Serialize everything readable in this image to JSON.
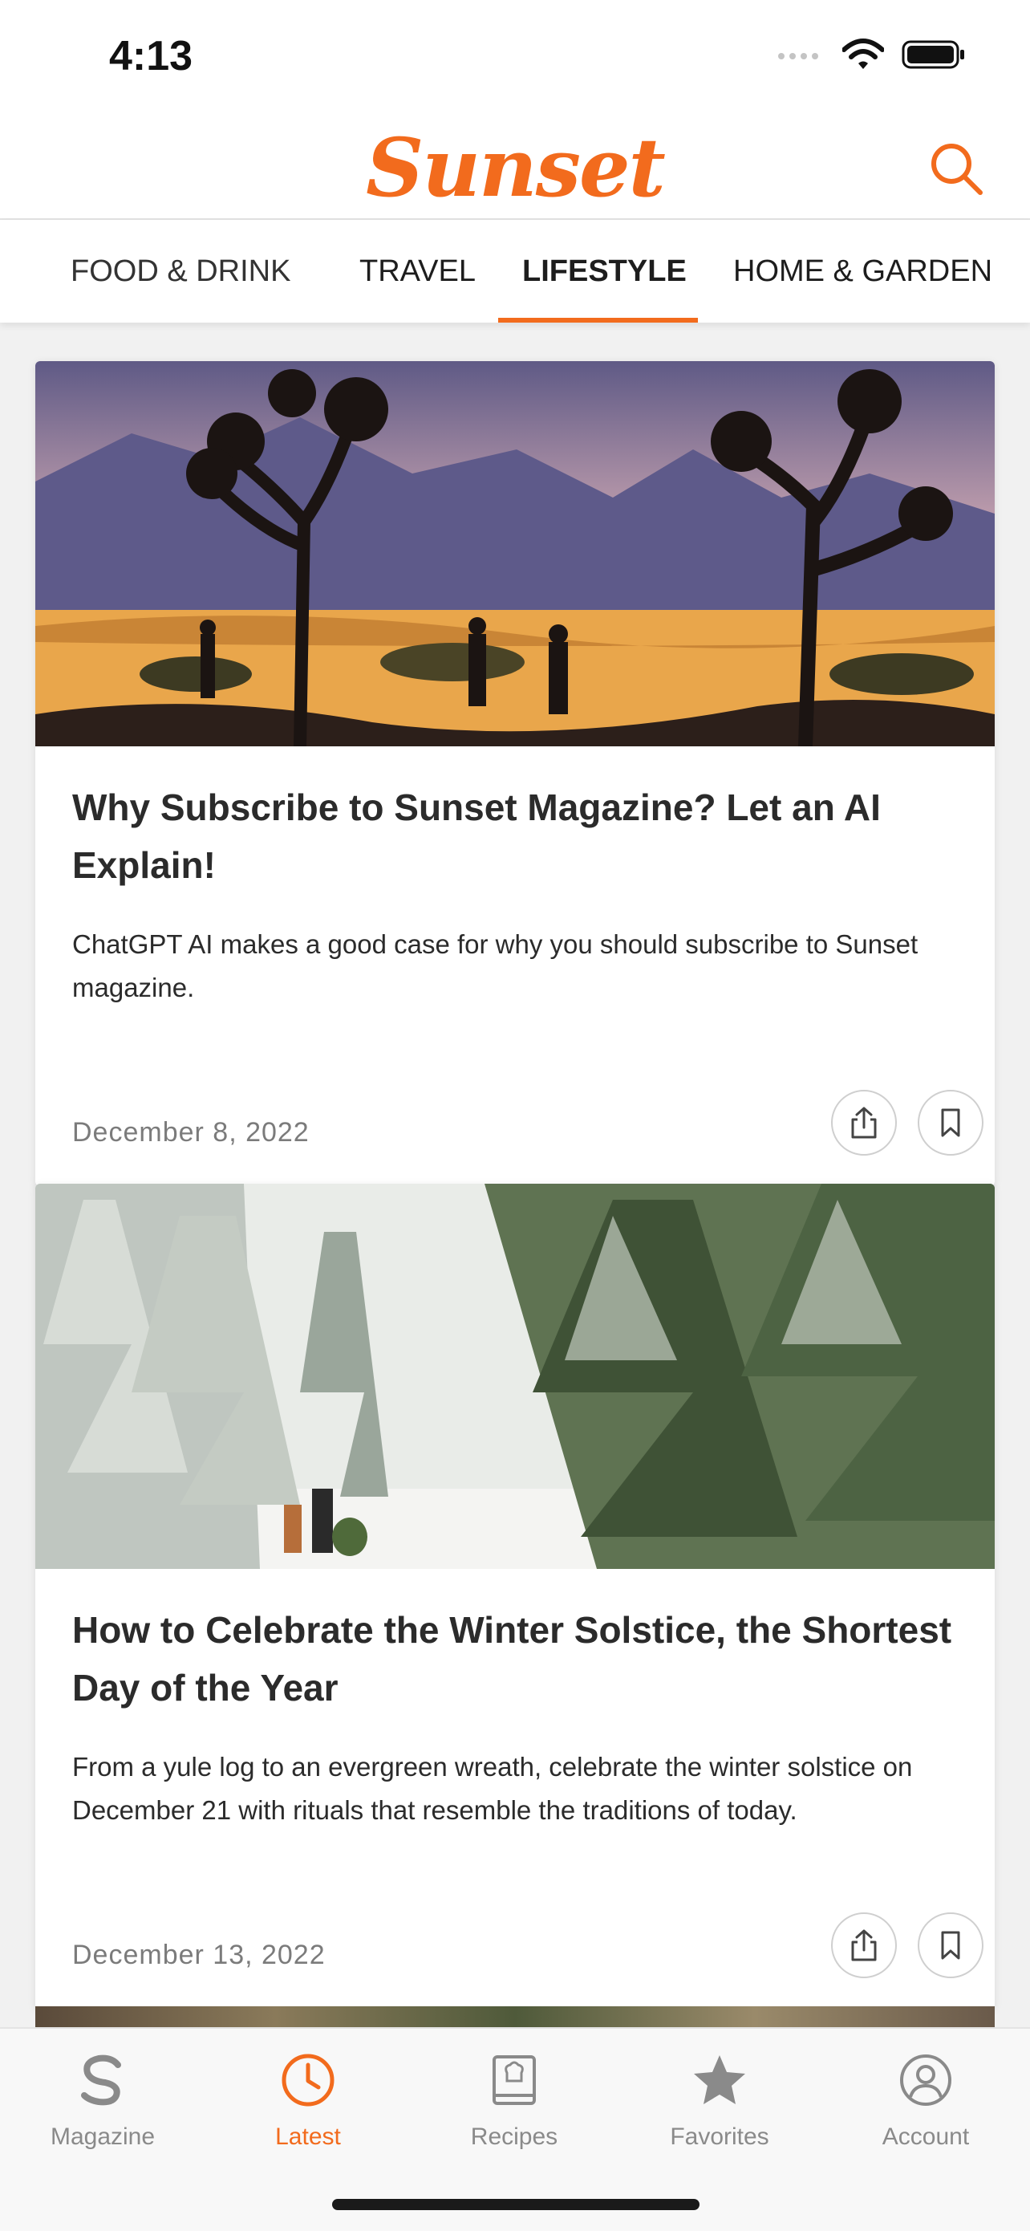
{
  "status_bar": {
    "time": "4:13"
  },
  "header": {
    "logo": "Sunset"
  },
  "tabs": [
    {
      "label": "Food & Drink",
      "active": false
    },
    {
      "label": "Travel",
      "active": false
    },
    {
      "label": "Lifestyle",
      "active": true
    },
    {
      "label": "Home & Garden",
      "active": false
    }
  ],
  "articles": [
    {
      "title": "Why Subscribe to Sunset Magazine? Let an AI Explain!",
      "description": "ChatGPT AI makes a good case for why you should subscribe to Sunset magazine.",
      "date": "December 8, 2022"
    },
    {
      "title": "How to Celebrate the Winter Solstice, the Shortest Day of the Year",
      "description": "From a yule log to an evergreen wreath, celebrate the winter solstice on December 21 with rituals that resemble the traditions of today.",
      "date": "December 13, 2022"
    }
  ],
  "tab_bar": [
    {
      "label": "Magazine",
      "icon": "magazine-s-icon",
      "active": false
    },
    {
      "label": "Latest",
      "icon": "clock-icon",
      "active": true
    },
    {
      "label": "Recipes",
      "icon": "recipe-book-icon",
      "active": false
    },
    {
      "label": "Favorites",
      "icon": "star-icon",
      "active": false
    },
    {
      "label": "Account",
      "icon": "person-icon",
      "active": false
    }
  ],
  "colors": {
    "accent": "#f26b1d",
    "inactive": "#8a8a8a",
    "background": "#f1f1f1"
  }
}
